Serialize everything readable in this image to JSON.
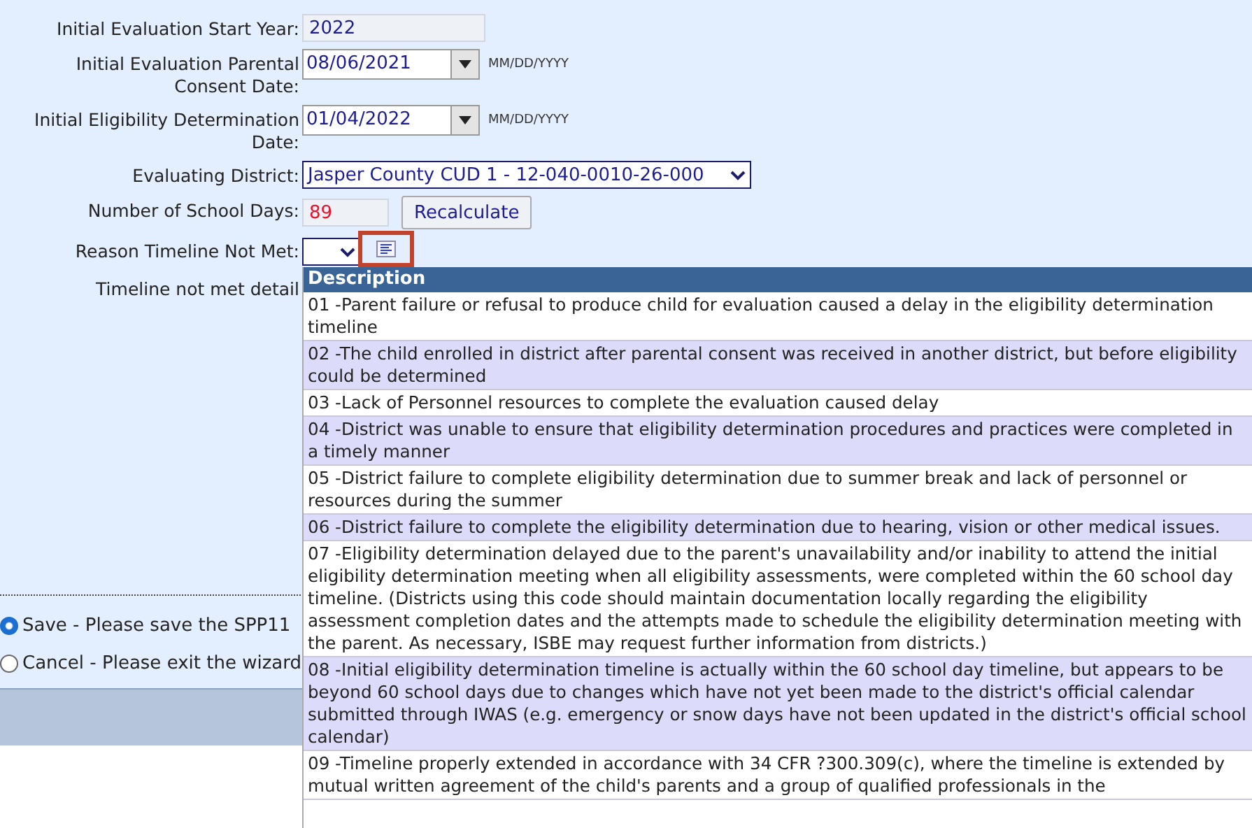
{
  "fields": [
    {
      "kind": "readonly",
      "label": "Initial Evaluation Start Year:",
      "value": "2022"
    },
    {
      "kind": "date",
      "label": "Initial Evaluation Parental Consent Date:",
      "value": "08/06/2021",
      "hint": "MM/DD/YYYY"
    },
    {
      "kind": "date",
      "label": "Initial Eligibility Determination Date:",
      "value": "01/04/2022",
      "hint": "MM/DD/YYYY"
    },
    {
      "kind": "select",
      "label": "Evaluating District:",
      "value": "Jasper County CUD 1 - 12-040-0010-26-000"
    },
    {
      "kind": "days",
      "label": "Number of School Days:",
      "value": "89",
      "button": "Recalculate"
    },
    {
      "kind": "reason",
      "label": "Reason Timeline Not Met:"
    },
    {
      "kind": "detail",
      "label": "Timeline not met detail"
    }
  ],
  "options": [
    {
      "label": "Save - Please save the SPP11",
      "selected": true
    },
    {
      "label": "Cancel - Please exit the wizard",
      "selected": false
    }
  ],
  "lookup": {
    "header": "Description",
    "rows": [
      "01 -Parent failure or refusal to produce child for evaluation caused a delay in the eligibility determination timeline",
      "02 -The child enrolled in district after parental consent was received in another district, but before eligibility could be determined",
      "03 -Lack of Personnel resources to complete the evaluation caused delay",
      "04 -District was unable to ensure that eligibility determination procedures and practices were completed in a timely manner",
      "05 -District failure to complete eligibility determination due to summer break and lack of personnel or resources during the summer",
      "06 -District failure to complete the eligibility determination due to hearing, vision or other medical issues.",
      "07 -Eligibility determination delayed due to the parent's unavailability and/or inability to attend the initial eligibility determination meeting when all eligibility assessments, were completed within the 60 school day timeline. (Districts using this code should maintain documentation locally regarding the eligibility assessment completion dates and the attempts made to schedule the eligibility determination meeting with the parent. As necessary, ISBE may request further information from districts.)",
      "08 -Initial eligibility determination timeline is actually within the 60 school day timeline, but appears to be beyond 60 school days due to changes which have not yet been made to the district's official calendar submitted through IWAS (e.g. emergency or snow days have not been updated in the district's official school calendar)",
      "09 -Timeline properly extended in accordance with 34 CFR ?300.309(c), where the timeline is extended by mutual written agreement of the child's parents and a group of qualified professionals in the"
    ]
  }
}
